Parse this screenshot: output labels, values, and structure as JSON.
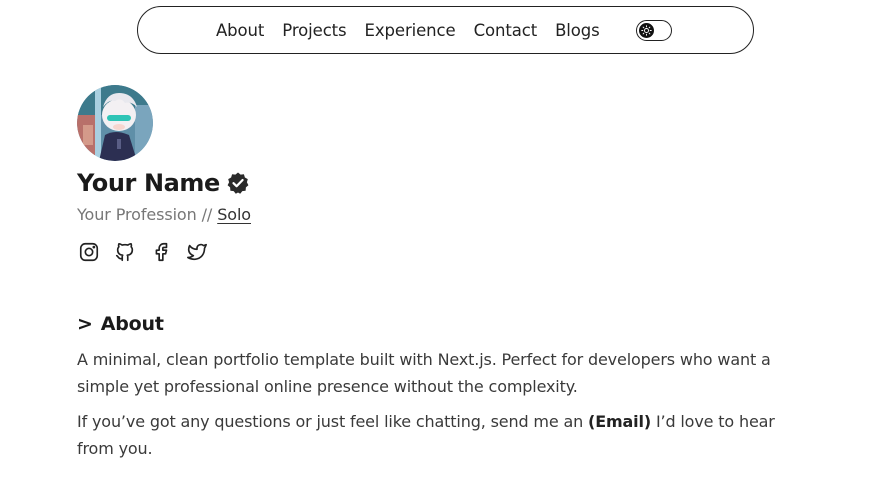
{
  "nav": {
    "links": [
      "About",
      "Projects",
      "Experience",
      "Contact",
      "Blogs"
    ],
    "theme_toggle_icon": "sun-icon"
  },
  "profile": {
    "avatar_icon": "avatar-anime-character",
    "name": "Your Name",
    "verified_icon": "verified-badge-icon",
    "profession": "Your Profession //",
    "profession_link": "Solo",
    "socials": [
      "instagram-icon",
      "github-icon",
      "facebook-icon",
      "twitter-icon"
    ]
  },
  "about": {
    "chevron": ">",
    "title": "About",
    "paragraph_1": "A minimal, clean portfolio template built with Next.js. Perfect for developers who want a simple yet professional online presence without the complexity.",
    "paragraph_2_before": "If you’ve got any questions or just feel like chatting, send me an",
    "paragraph_2_link": "(Email)",
    "paragraph_2_after": "I’d love to hear from you."
  },
  "colors": {
    "text": "#1f1f1f",
    "muted": "#777777",
    "border": "#222222",
    "background": "#ffffff"
  }
}
